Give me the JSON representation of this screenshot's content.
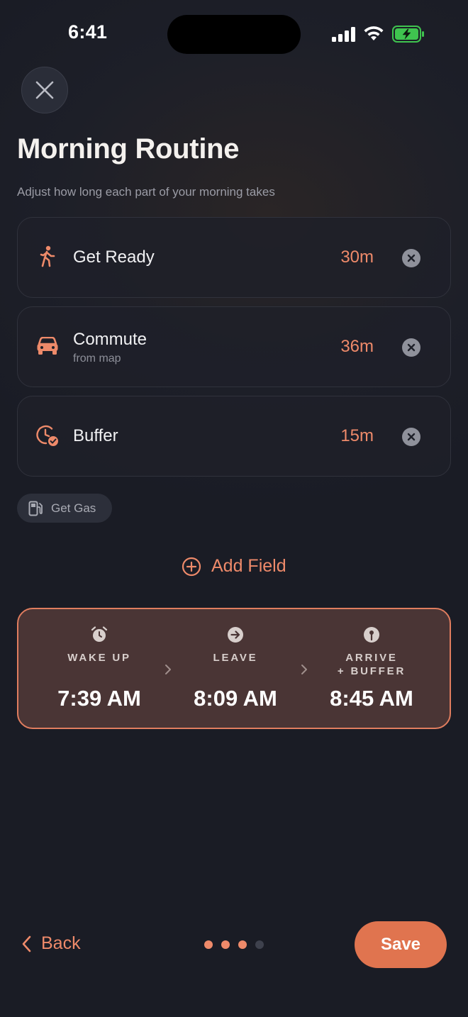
{
  "status_bar": {
    "time": "6:41"
  },
  "header": {
    "title": "Morning Routine",
    "subtitle": "Adjust how long each part of your morning takes"
  },
  "routine": [
    {
      "label": "Get Ready",
      "sublabel": "",
      "duration": "30m",
      "icon": "walking-person-icon"
    },
    {
      "label": "Commute",
      "sublabel": "from map",
      "duration": "36m",
      "icon": "car-icon"
    },
    {
      "label": "Buffer",
      "sublabel": "",
      "duration": "15m",
      "icon": "clock-check-icon"
    }
  ],
  "suggestion_chip": {
    "label": "Get Gas",
    "icon": "gas-pump-icon"
  },
  "add_field": {
    "label": "Add Field"
  },
  "summary": {
    "wake": {
      "label": "WAKE UP",
      "time": "7:39 AM",
      "icon": "alarm-clock-icon"
    },
    "leave": {
      "label": "LEAVE",
      "time": "8:09 AM",
      "icon": "arrow-right-circle-icon"
    },
    "arrive": {
      "label_line1": "ARRIVE",
      "label_line2": "+ BUFFER",
      "time": "8:45 AM",
      "icon": "pin-icon"
    }
  },
  "footer": {
    "back_label": "Back",
    "save_label": "Save",
    "pages_total": 4,
    "pages_active": 3
  },
  "colors": {
    "accent": "#ee8a6a",
    "save_button": "#e0744f",
    "summary_bg": "#4a3535",
    "summary_border": "#e07d5f",
    "background": "#1b1d26"
  }
}
